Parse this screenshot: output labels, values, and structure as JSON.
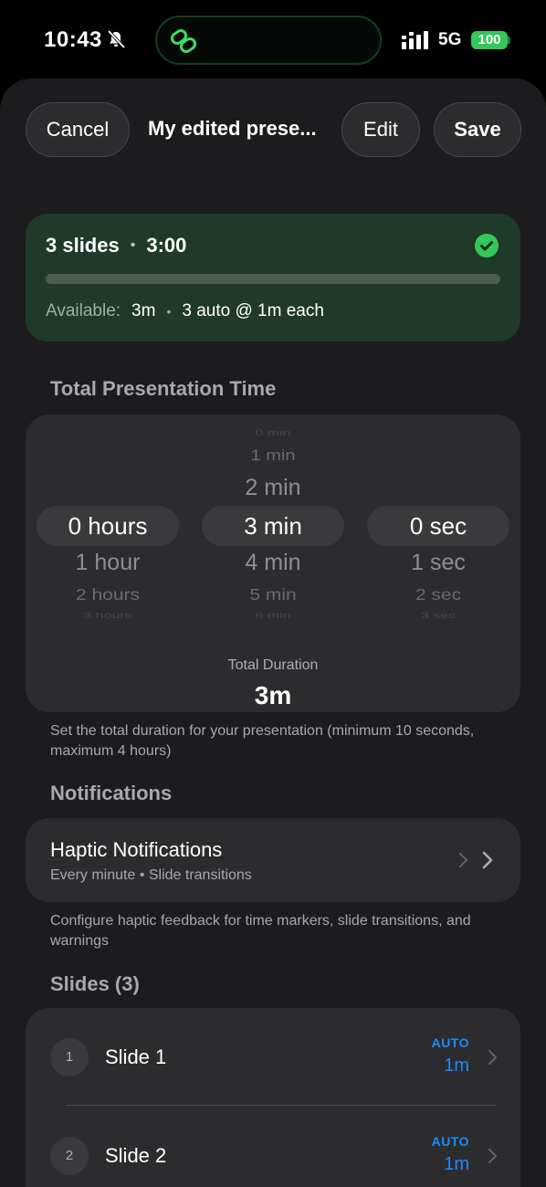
{
  "status_bar": {
    "time": "10:43",
    "network": "5G",
    "battery": "100",
    "icons": [
      "bell-slash-icon",
      "link-icon",
      "signal-bars-icon",
      "battery-icon"
    ]
  },
  "nav": {
    "cancel_label": "Cancel",
    "title": "My edited prese...",
    "edit_label": "Edit",
    "save_label": "Save"
  },
  "summary": {
    "slides": "3 slides",
    "separator": "•",
    "duration": "3:00",
    "available_label": "Available:",
    "available_value": "3m",
    "auto_info": "3 auto @ 1m each",
    "allocated_fraction": 1.0,
    "status_icon": "checkmark-circle-icon",
    "accent_color": "#34c759"
  },
  "total_time": {
    "section_title": "Total Presentation Time",
    "hours": {
      "above": [],
      "selected": "0 hours",
      "below": [
        "1 hour",
        "2 hours",
        "3 hours"
      ]
    },
    "minutes": {
      "above": [
        "0 min",
        "1 min",
        "2 min"
      ],
      "selected": "3 min",
      "below": [
        "4 min",
        "5 min",
        "6 min"
      ]
    },
    "seconds": {
      "above": [],
      "selected": "0 sec",
      "below": [
        "1 sec",
        "2 sec",
        "3 sec"
      ]
    },
    "duration_label": "Total Duration",
    "duration_value": "3m",
    "helper": "Set the total duration for your presentation (minimum 10 seconds, maximum 4 hours)"
  },
  "notifications": {
    "section_title": "Notifications",
    "haptic_title": "Haptic Notifications",
    "haptic_subtitle": "Every minute • Slide transitions",
    "helper": "Configure haptic feedback for time markers, slide transitions, and warnings"
  },
  "slides": {
    "section_title": "Slides (3)",
    "items": [
      {
        "number": "1",
        "name": "Slide 1",
        "mode": "AUTO",
        "duration": "1m"
      },
      {
        "number": "2",
        "name": "Slide 2",
        "mode": "AUTO",
        "duration": "1m"
      }
    ],
    "link_color": "#1a8cff"
  }
}
